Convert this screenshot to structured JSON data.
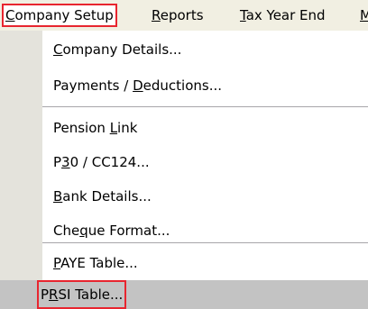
{
  "menubar": {
    "items": [
      {
        "pre": "",
        "u": "C",
        "post": "ompany Setup"
      },
      {
        "pre": "",
        "u": "R",
        "post": "eports"
      },
      {
        "pre": "",
        "u": "T",
        "post": "ax Year End"
      },
      {
        "pre": "",
        "u": "M",
        "post": ""
      }
    ]
  },
  "menu": {
    "items": [
      {
        "pre": "",
        "u": "C",
        "post": "ompany Details..."
      },
      {
        "pre": "Payments / ",
        "u": "D",
        "post": "eductions..."
      },
      {
        "pre": "Pension ",
        "u": "L",
        "post": "ink"
      },
      {
        "pre": "P",
        "u": "3",
        "post": "0 / CC124..."
      },
      {
        "pre": "",
        "u": "B",
        "post": "ank Details..."
      },
      {
        "pre": "Che",
        "u": "q",
        "post": "ue Format..."
      },
      {
        "pre": "",
        "u": "P",
        "post": "AYE Table..."
      },
      {
        "pre": "P",
        "u": "R",
        "post": "SI Table..."
      }
    ]
  }
}
